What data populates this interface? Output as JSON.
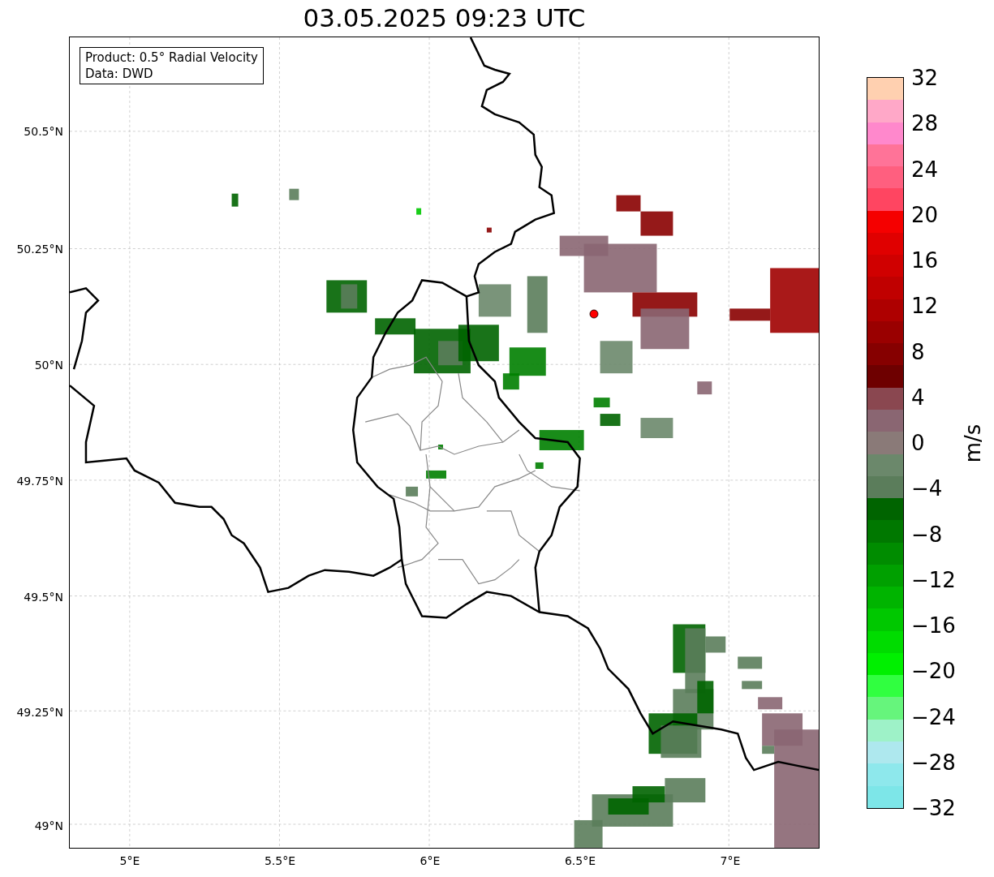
{
  "title": "03.05.2025 09:23 UTC",
  "info_box": {
    "lines": [
      "Product: 0.5° Radial Velocity",
      "Data: DWD"
    ]
  },
  "lat_ticks": [
    "50.5°N",
    "50.25°N",
    "50°N",
    "49.75°N",
    "49.5°N",
    "49.25°N",
    "49°N"
  ],
  "lon_ticks": [
    "5°E",
    "5.5°E",
    "6°E",
    "6.5°E",
    "7°E"
  ],
  "colorbar": {
    "label": "m/s",
    "ticks": [
      "32",
      "28",
      "24",
      "20",
      "16",
      "12",
      "8",
      "4",
      "0",
      "−4",
      "−8",
      "−12",
      "−16",
      "−20",
      "−24",
      "−28",
      "−32"
    ],
    "segments": [
      {
        "color": "#ffd0b0"
      },
      {
        "color": "#ffa8c8"
      },
      {
        "color": "#ff88cc"
      },
      {
        "color": "#ff7398"
      },
      {
        "color": "#ff5f7f"
      },
      {
        "color": "#ff4561"
      },
      {
        "color": "#f50000"
      },
      {
        "color": "#e00000"
      },
      {
        "color": "#d00000"
      },
      {
        "color": "#c00000"
      },
      {
        "color": "#ae0000"
      },
      {
        "color": "#9a0000"
      },
      {
        "color": "#860000"
      },
      {
        "color": "#6e0000"
      },
      {
        "color": "#8a4750"
      },
      {
        "color": "#8a6672"
      },
      {
        "color": "#8a7a78"
      },
      {
        "color": "#6b886b"
      },
      {
        "color": "#5b7d5b"
      },
      {
        "color": "#006400"
      },
      {
        "color": "#007800"
      },
      {
        "color": "#008c00"
      },
      {
        "color": "#00a000"
      },
      {
        "color": "#00b400"
      },
      {
        "color": "#00c800"
      },
      {
        "color": "#00dc00"
      },
      {
        "color": "#00f000"
      },
      {
        "color": "#30ff40"
      },
      {
        "color": "#66f57c"
      },
      {
        "color": "#9ef2c8"
      },
      {
        "color": "#aee8ee"
      },
      {
        "color": "#8ee8ec"
      },
      {
        "color": "#7de6e8"
      }
    ]
  }
}
